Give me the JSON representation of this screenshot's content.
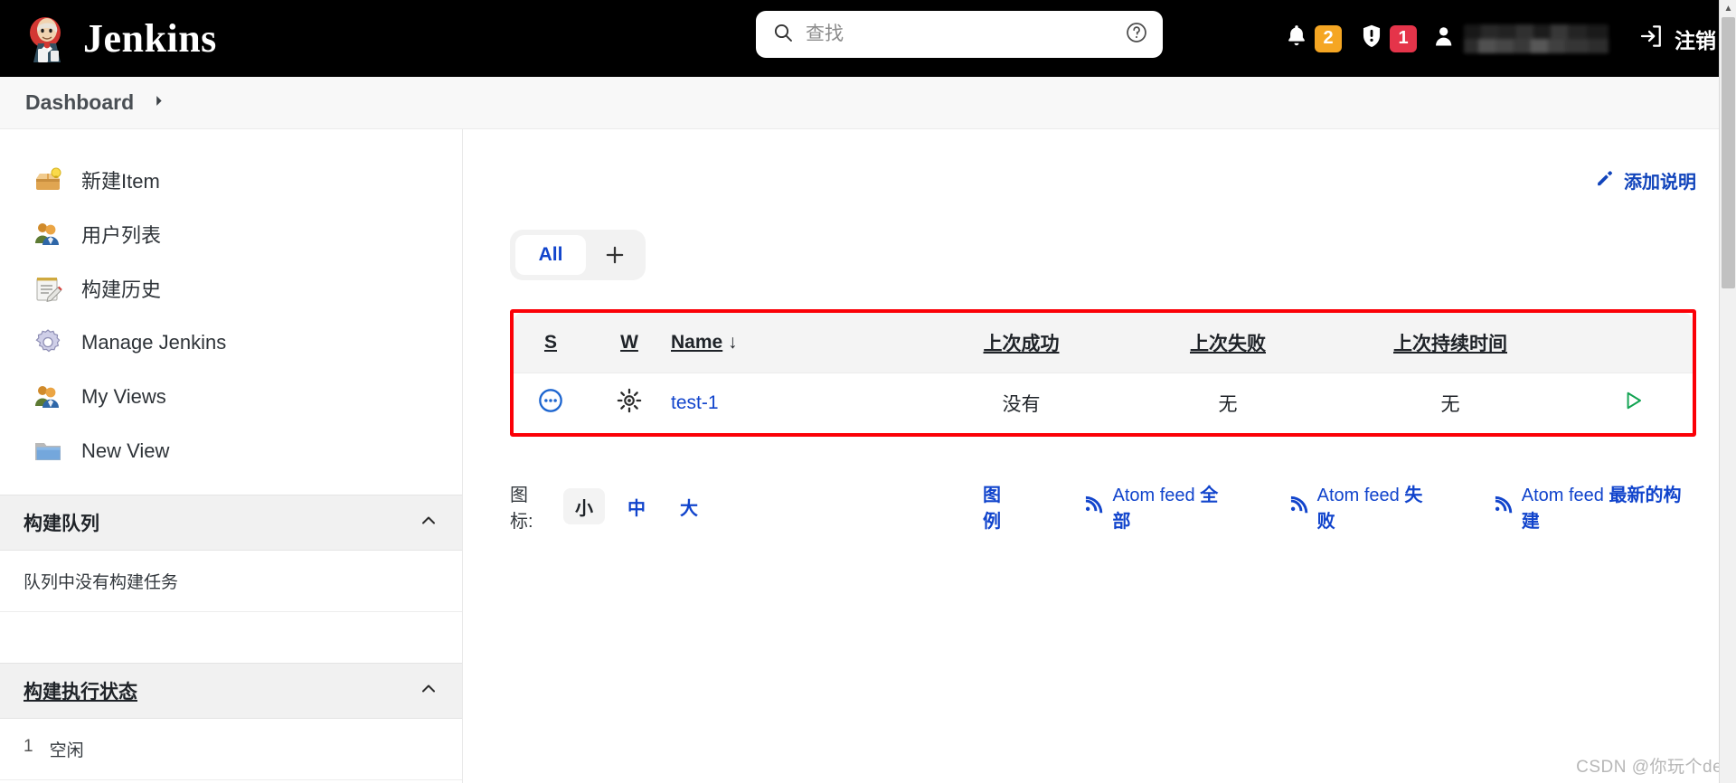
{
  "header": {
    "brand": "Jenkins",
    "search": {
      "placeholder": "查找",
      "value": "",
      "icon": "search-icon",
      "help_icon": "help-circle-icon"
    },
    "notifications": {
      "icon": "bell-icon",
      "count": "2",
      "color": "#f5a623"
    },
    "security": {
      "icon": "shield-warning-icon",
      "count": "1",
      "color": "#e5344a"
    },
    "user": {
      "icon": "user-avatar-icon",
      "name_masked": ""
    },
    "logout": {
      "label": "注销",
      "icon": "logout-icon"
    }
  },
  "breadcrumb": {
    "items": [
      "Dashboard"
    ],
    "caret_icon": "chevron-right-icon"
  },
  "sidebar": {
    "items": [
      {
        "label": "新建Item",
        "icon": "new-item-box-icon"
      },
      {
        "label": "用户列表",
        "icon": "people-icon"
      },
      {
        "label": "构建历史",
        "icon": "notepad-pencil-icon"
      },
      {
        "label": "Manage Jenkins",
        "icon": "gear-icon"
      },
      {
        "label": "My Views",
        "icon": "people-icon"
      },
      {
        "label": "New View",
        "icon": "folder-icon"
      }
    ],
    "build_queue": {
      "title": "构建队列",
      "collapse_icon": "chevron-up-icon",
      "empty_text": "队列中没有构建任务"
    },
    "build_executor": {
      "title": "构建执行状态",
      "collapse_icon": "chevron-up-icon",
      "executors": [
        {
          "num": "1",
          "status": "空闲"
        }
      ]
    }
  },
  "main": {
    "add_description": {
      "label": "添加说明",
      "icon": "pencil-icon"
    },
    "tabs": [
      {
        "label": "All",
        "active": true
      }
    ],
    "tab_add": {
      "icon": "plus-icon",
      "label": "+"
    },
    "table": {
      "highlight_color": "#fb0007",
      "headers": [
        {
          "label": "S",
          "sortable": true
        },
        {
          "label": "W",
          "sortable": true
        },
        {
          "label": "Name",
          "sortable": true,
          "sort_indicator": "↓"
        },
        {
          "label": "上次成功",
          "sortable": true
        },
        {
          "label": "上次失败",
          "sortable": true
        },
        {
          "label": "上次持续时间",
          "sortable": true
        },
        {
          "label": "",
          "sortable": false
        }
      ],
      "rows": [
        {
          "status_icon": "pending-status-icon",
          "weather_icon": "weather-sunny-icon",
          "name": "test-1",
          "last_success": "没有",
          "last_failure": "无",
          "last_duration": "无",
          "action_icon": "play-build-icon"
        }
      ]
    },
    "footer": {
      "icon_size_label": "图标:",
      "sizes": [
        {
          "label": "小",
          "active": true
        },
        {
          "label": "中",
          "active": false
        },
        {
          "label": "大",
          "active": false
        }
      ],
      "legend": "图例",
      "feeds": [
        {
          "prefix": "Atom feed ",
          "suffix": "全部",
          "icon": "rss-icon"
        },
        {
          "prefix": "Atom feed ",
          "suffix": "失败",
          "icon": "rss-icon"
        },
        {
          "prefix": "Atom feed ",
          "suffix": "最新的构建",
          "icon": "rss-icon"
        }
      ]
    }
  },
  "watermark": "CSDN @你玩个der"
}
